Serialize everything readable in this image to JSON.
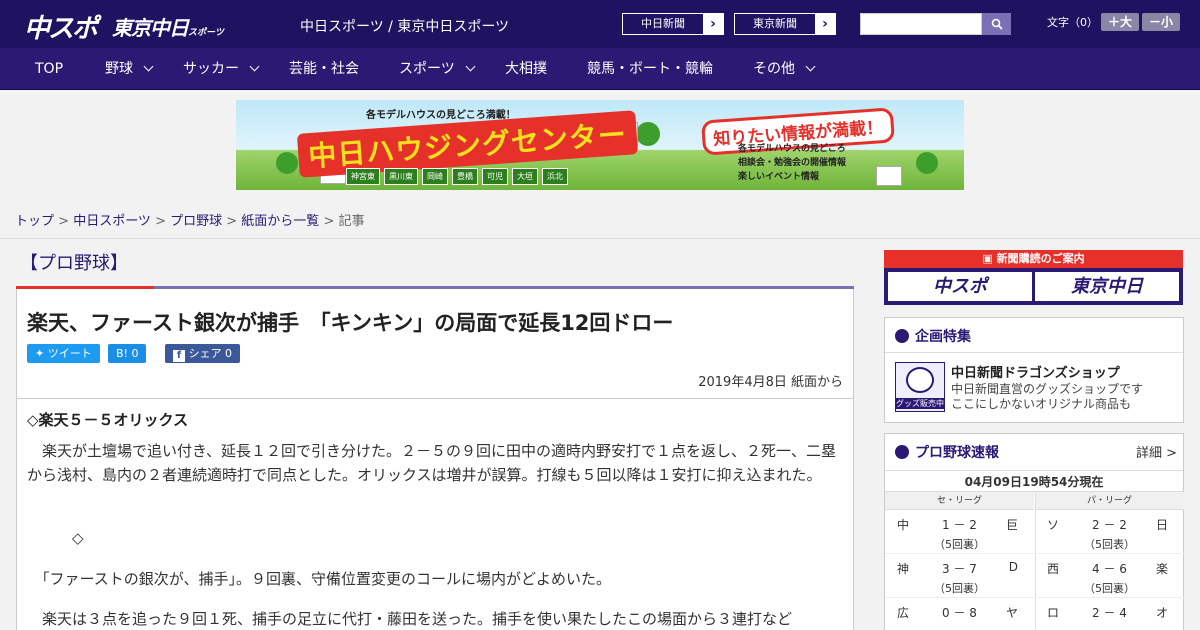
{
  "header": {
    "logo_chuspo": "中スポ",
    "logo_tokyo": "東京中日",
    "logo_tokyo_suffix": "スポーツ",
    "site_title": "中日スポーツ / 東京中日スポーツ",
    "ext_link_1": "中日新聞",
    "ext_link_2": "東京新聞",
    "font_label": "文字（0）",
    "font_plus": "＋大",
    "font_minus": "－小"
  },
  "nav": {
    "items": [
      "TOP",
      "野球",
      "サッカー",
      "芸能・社会",
      "スポーツ",
      "大相撲",
      "競馬・ボート・競輪",
      "その他"
    ]
  },
  "banner": {
    "subtitle": "各モデルハウスの見どころ満載！",
    "title": "中日ハウジングセンター",
    "tags": [
      "神宮東",
      "黒川東",
      "岡崎",
      "豊橋",
      "可児",
      "大垣",
      "浜北"
    ],
    "bubble": "知りたい情報が満載！",
    "list": [
      "各モデルハウスの見どころ",
      "相談会・勉強会の開催情報",
      "楽しいイベント情報"
    ]
  },
  "breadcrumb": {
    "items": [
      "トップ",
      "中日スポーツ",
      "プロ野球",
      "紙面から一覧"
    ],
    "current": "記事"
  },
  "article": {
    "category": "【プロ野球】",
    "headline": "楽天、ファースト銀次が捕手　「キンキン」の局面で延長12回ドロー",
    "share_tweet": "ツイート",
    "share_hatena": "B! 0",
    "share_fb": "シェア 0",
    "date": "2019年4月8日 紙面から",
    "subhead": "◇楽天５－５オリックス",
    "para1": "　楽天が土壇場で追い付き、延長１２回で引き分けた。２－５の９回に田中の適時内野安打で１点を返し、２死一、二塁から浅村、島内の２者連続適時打で同点とした。オリックスは増井が誤算。打線も５回以降は１安打に抑え込まれた。",
    "para2": "　　　◇",
    "para3": "　「ファーストの銀次が、捕手」。９回裏、守備位置変更のコールに場内がどよめいた。",
    "para4": "　楽天は３点を追った９回１死、捕手の足立に代打・藤田を送った。捕手を使い果たしたこの場面から３連打など"
  },
  "sidebar": {
    "subscribe_head": "新聞購読のご案内",
    "subscribe_logo1": "中スポ",
    "subscribe_logo2": "東京中日",
    "feature_title": "企画特集",
    "shop_thumb_label": "グッズ販売中",
    "shop_name": "中日新聞ドラゴンズショップ",
    "shop_desc1": "中日新聞直営のグッズショップです",
    "shop_desc2": "ここにしかないオリジナル商品も",
    "score_title": "プロ野球速報",
    "score_detail": "詳細 >",
    "score_time": "04月09日19時54分現在",
    "league_central": "セ・リーグ",
    "league_pacific": "パ・リーグ",
    "central_games": [
      {
        "t1": "中",
        "score": "1 － 2",
        "t2": "巨",
        "status": "（5回裏）"
      },
      {
        "t1": "神",
        "score": "3 － 7",
        "t2": "D",
        "status": "（5回裏）"
      },
      {
        "t1": "広",
        "score": "0 － 8",
        "t2": "ヤ",
        "status": ""
      }
    ],
    "pacific_games": [
      {
        "t1": "ソ",
        "score": "2 － 2",
        "t2": "日",
        "status": "（5回表）"
      },
      {
        "t1": "西",
        "score": "4 － 6",
        "t2": "楽",
        "status": "（5回裏）"
      },
      {
        "t1": "ロ",
        "score": "2 － 4",
        "t2": "オ",
        "status": ""
      }
    ]
  }
}
